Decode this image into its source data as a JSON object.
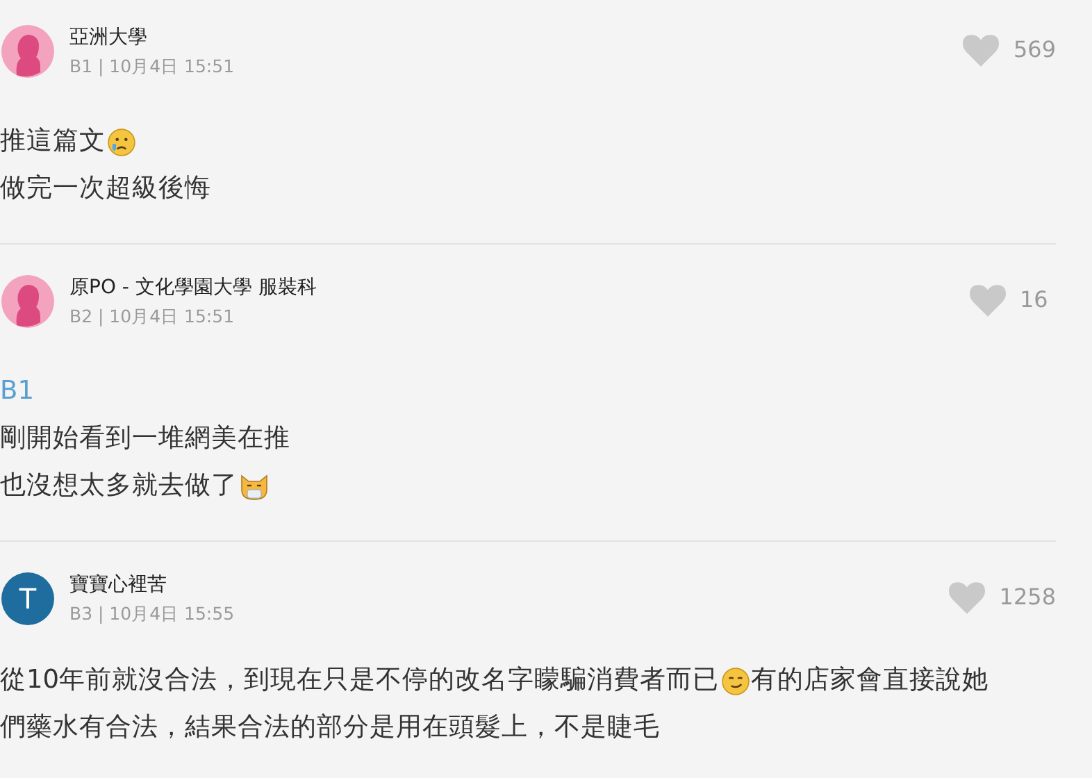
{
  "comments": [
    {
      "avatar": {
        "kind": "female"
      },
      "author": "亞洲大學",
      "meta": "B1 | 10月4日 15:51",
      "likes": "569",
      "lines": [
        [
          {
            "kind": "text",
            "text": "推這篇文"
          },
          {
            "kind": "sad_face"
          }
        ],
        [
          {
            "kind": "text",
            "text": "做完一次超級後悔"
          }
        ]
      ]
    },
    {
      "avatar": {
        "kind": "female"
      },
      "author": "原PO - 文化學園大學 服裝科",
      "meta": "B2 | 10月4日 15:51",
      "likes": "16",
      "lines": [
        [
          {
            "kind": "reply_ref",
            "text": "B1"
          }
        ],
        [
          {
            "kind": "text",
            "text": "剛開始看到一堆網美在推"
          }
        ],
        [
          {
            "kind": "text",
            "text": "也沒想太多就去做了"
          },
          {
            "kind": "cat_face"
          }
        ]
      ]
    },
    {
      "avatar": {
        "kind": "letter",
        "letter": "T"
      },
      "author": "寶寶心裡苦",
      "meta": "B3 | 10月4日 15:55",
      "likes": "1258",
      "lines": [
        [
          {
            "kind": "text",
            "text": "從10年前就沒合法，到現在只是不停的改名字矇騙消費者而已"
          },
          {
            "kind": "smirk_face"
          },
          {
            "kind": "text",
            "text": "有的店家會直接說她"
          }
        ],
        [
          {
            "kind": "text",
            "text": "們藥水有合法，結果合法的部分是用在頭髮上，不是睫毛"
          }
        ]
      ]
    }
  ]
}
